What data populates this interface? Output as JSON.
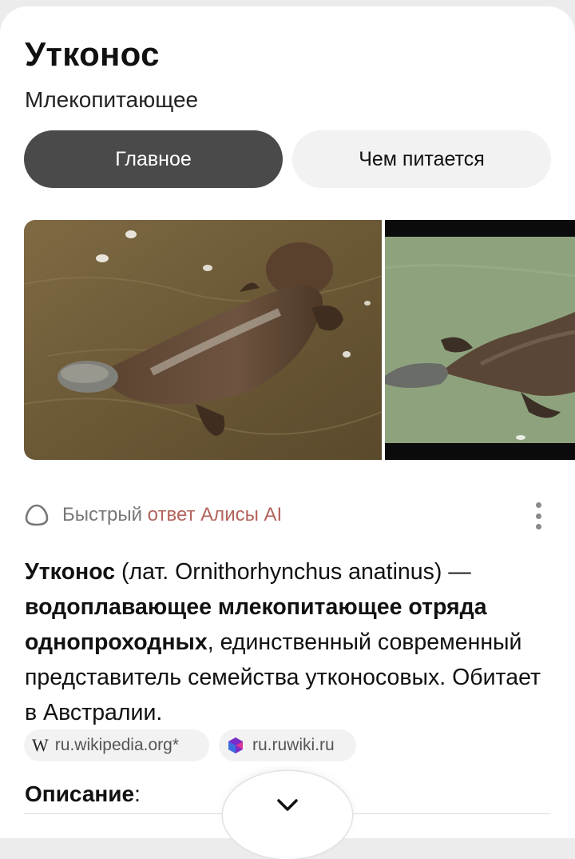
{
  "card": {
    "title": "Утконос",
    "subtitle": "Млекопитающее"
  },
  "tabs": [
    {
      "label": "Главное",
      "active": true
    },
    {
      "label": "Чем питается",
      "active": false
    }
  ],
  "gallery": {
    "images": [
      "platypus-swimming-photo",
      "platypus-swimming-photo-2"
    ]
  },
  "ai_answer": {
    "icon": "alice-ring-icon",
    "label_prefix": "Быстрый",
    "label_suffix": "ответ Алисы AI",
    "accent_color": "#b3645c",
    "menu_icon": "kebab-menu-icon",
    "term": "Утконос",
    "latin": " (лат. Ornithorhynchus anatinus) — ",
    "definition_bold": "водоплавающее млекопитающее отряда однопроходных",
    "rest": ", единственный современный представитель семейства утконосовых. Обитает в Австралии."
  },
  "sources": [
    {
      "icon": "wikipedia-icon",
      "glyph": "W",
      "label": "ru.wikipedia.org*"
    },
    {
      "icon": "ruwiki-icon",
      "label": "ru.ruwiki.ru"
    }
  ],
  "description": {
    "heading": "Описание",
    "colon": ":"
  },
  "expand_button": {
    "icon": "chevron-down-icon"
  },
  "colors": {
    "active_tab_bg": "#4a4a4a",
    "inactive_tab_bg": "#f2f2f3"
  }
}
